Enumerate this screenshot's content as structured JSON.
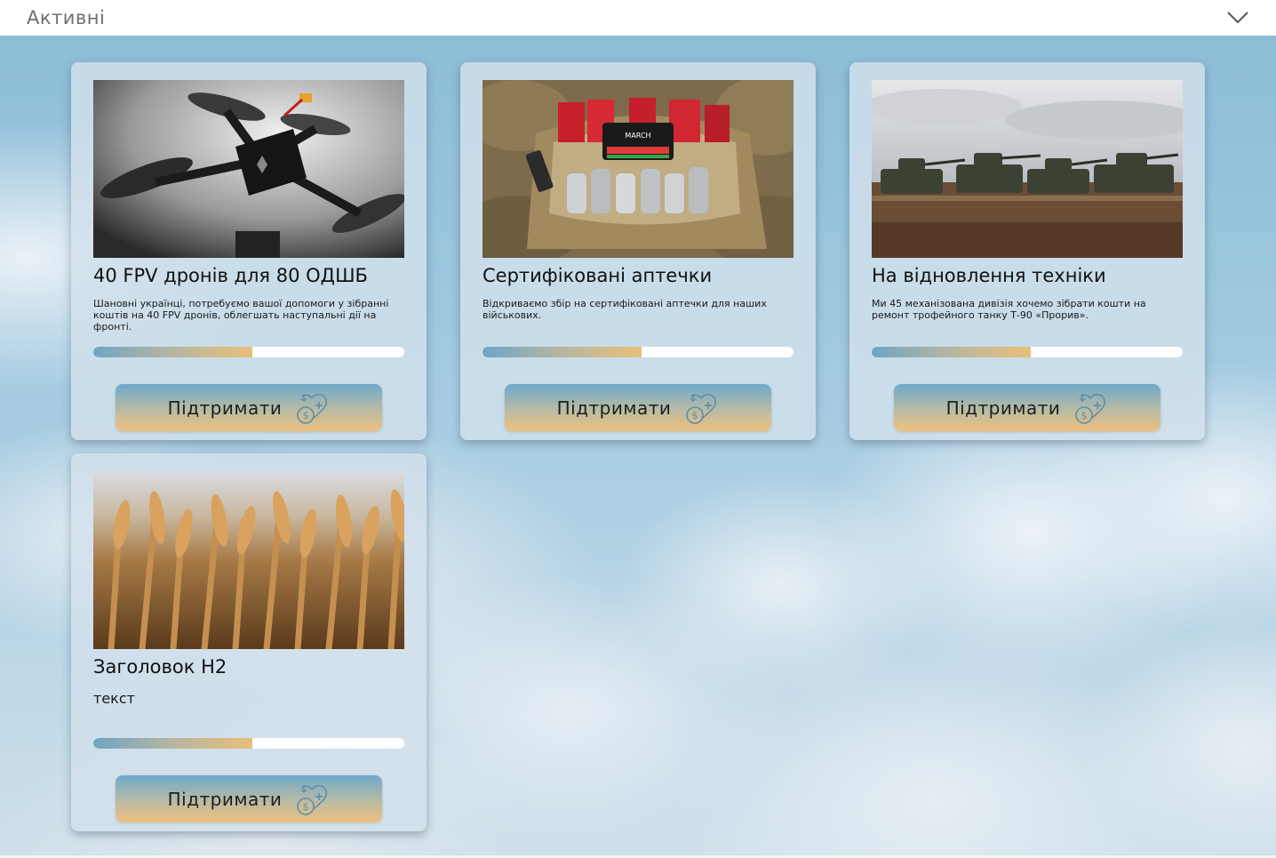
{
  "header": {
    "title": "Активні",
    "toggle_icon": "chevron-down-icon"
  },
  "colors": {
    "card_bg": "#d2e1eb",
    "progress_start": "#6fa5c3",
    "progress_end": "#e8bf7a",
    "button_top": "#6fa9cb",
    "button_bottom": "#f0c07e"
  },
  "cards": [
    {
      "image": "fpv-drone-photo",
      "title": "40 FPV дронів для 80 ОДШБ",
      "description": "Шановні українці, потребуємо вашої допомоги у зібранні коштів на 40 FPV дронів, облегшать наступальні дії на фронті.",
      "progress": 0.51,
      "button_label": "Підтримати",
      "button_icon": "donate-heart-icon"
    },
    {
      "image": "first-aid-kit-photo",
      "title": "Сертифіковані аптечки",
      "description": "Відкриваємо збір на сертифіковані аптечки для наших військових.",
      "progress": 0.51,
      "button_label": "Підтримати",
      "button_icon": "donate-heart-icon"
    },
    {
      "image": "tanks-field-photo",
      "title": "На відновлення техніки",
      "description": "Ми 45 механізована дивізія хочемо зібрати кошти на ремонт трофейного танку Т-90 «Прорив».",
      "progress": 0.51,
      "button_label": "Підтримати",
      "button_icon": "donate-heart-icon"
    },
    {
      "image": "wheat-field-photo",
      "title": "Заголовок H2",
      "description": "текст",
      "progress": 0.51,
      "button_label": "Підтримати",
      "button_icon": "donate-heart-icon"
    }
  ]
}
